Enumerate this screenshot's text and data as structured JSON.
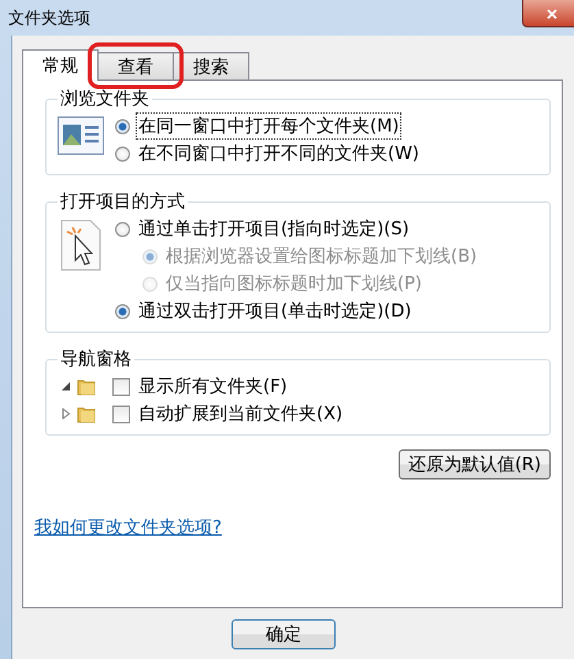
{
  "window": {
    "title": "文件夹选项",
    "close": "×"
  },
  "tabs": [
    {
      "label": "常规",
      "selected": true,
      "highlighted": false
    },
    {
      "label": "查看",
      "selected": false,
      "highlighted": true
    },
    {
      "label": "搜索",
      "selected": false,
      "highlighted": false
    }
  ],
  "groups": [
    {
      "title": "浏览文件夹",
      "kind": "radios",
      "options": [
        {
          "label": "在同一窗口中打开每个文件夹(M)",
          "selected": true,
          "disabled": false,
          "focused": true
        },
        {
          "label": "在不同窗口中打开不同的文件夹(W)",
          "selected": false,
          "disabled": false,
          "focused": false
        }
      ]
    },
    {
      "title": "打开项目的方式",
      "kind": "radios",
      "options": [
        {
          "label": "通过单击打开项目(指向时选定)(S)",
          "selected": false,
          "disabled": false,
          "focused": false,
          "children": [
            {
              "label": "根据浏览器设置给图标标题加下划线(B)",
              "selected": true,
              "disabled": true,
              "focused": false
            },
            {
              "label": "仅当指向图标标题时加下划线(P)",
              "selected": false,
              "disabled": true,
              "focused": false
            }
          ]
        },
        {
          "label": "通过双击打开项目(单击时选定)(D)",
          "selected": true,
          "disabled": false,
          "focused": false
        }
      ]
    },
    {
      "title": "导航窗格",
      "kind": "tree",
      "options": [
        {
          "label": "显示所有文件夹(F)",
          "checked": false,
          "expanded": true
        },
        {
          "label": "自动扩展到当前文件夹(X)",
          "checked": false,
          "expanded": false
        }
      ]
    }
  ],
  "reset_button": "还原为默认值(R)",
  "help_link": "我如何更改文件夹选项?",
  "buttons": [
    "确定"
  ]
}
